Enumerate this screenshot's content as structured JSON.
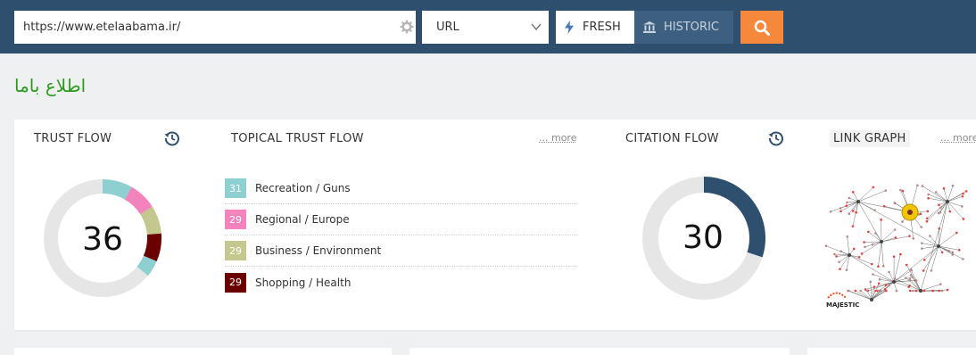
{
  "search": {
    "url_value": "https://www.etelaabama.ir/",
    "mode_selected": "URL",
    "fresh_label": "FRESH",
    "historic_label": "HISTORIC",
    "icons": {
      "settings": "gear-icon",
      "dropdown": "chevron-down-icon",
      "fresh": "lightning-icon",
      "historic": "bank-icon",
      "search": "magnifier-icon"
    }
  },
  "site_title": "اطلاع باما",
  "trust_flow": {
    "heading": "TRUST FLOW",
    "value": "36",
    "history_icon": "history-clock-icon"
  },
  "topical_trust_flow": {
    "heading": "TOPICAL TRUST FLOW",
    "more_label": "... more",
    "items": [
      {
        "value": "31",
        "label": "Recreation / Guns",
        "color": "#8ecfd1"
      },
      {
        "value": "29",
        "label": "Regional / Europe",
        "color": "#f283bd"
      },
      {
        "value": "29",
        "label": "Business / Environment",
        "color": "#c4c88e"
      },
      {
        "value": "29",
        "label": "Shopping / Health",
        "color": "#6a0000"
      }
    ]
  },
  "citation_flow": {
    "heading": "CITATION FLOW",
    "value": "30",
    "history_icon": "history-clock-icon",
    "color": "#2f4f6e"
  },
  "link_graph": {
    "heading": "LINK GRAPH",
    "more_label": "... more",
    "logo_text": "MAJESTIC"
  },
  "colors": {
    "topbar": "#2f4f6e",
    "search_button": "#f5883b",
    "title": "#2e9a1f",
    "ring_bg": "#e6e6e6"
  }
}
